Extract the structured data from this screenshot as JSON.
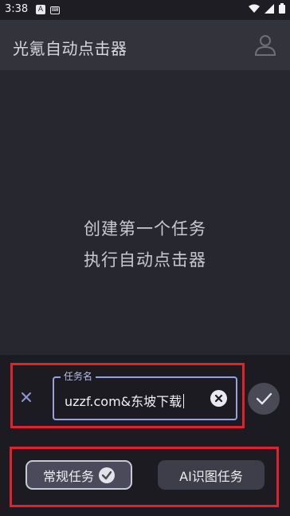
{
  "status_bar": {
    "time": "3:38",
    "notification_icons": [
      "android-icon",
      "keyboard-icon"
    ],
    "system_icons": [
      "wifi-icon",
      "signal-icon",
      "battery-icon"
    ]
  },
  "app_bar": {
    "title": "光氪自动点击器",
    "avatar_icon": "user-icon"
  },
  "empty_state": {
    "line1": "创建第一个任务",
    "line2": "执行自动点击器"
  },
  "task_sheet": {
    "field_label": "任务名",
    "field_value": "uzzf.com&东坡下载",
    "close_icon": "close-icon",
    "clear_icon": "clear-icon",
    "confirm_icon": "check-icon",
    "task_types": [
      {
        "label": "常规任务",
        "selected": true
      },
      {
        "label": "AI识图任务",
        "selected": false
      }
    ]
  },
  "colors": {
    "background": "#27272f",
    "app_bar": "#33333b",
    "sheet": "#1b1b21",
    "field_outline": "#9aa0d8",
    "highlight": "#e0232a"
  }
}
